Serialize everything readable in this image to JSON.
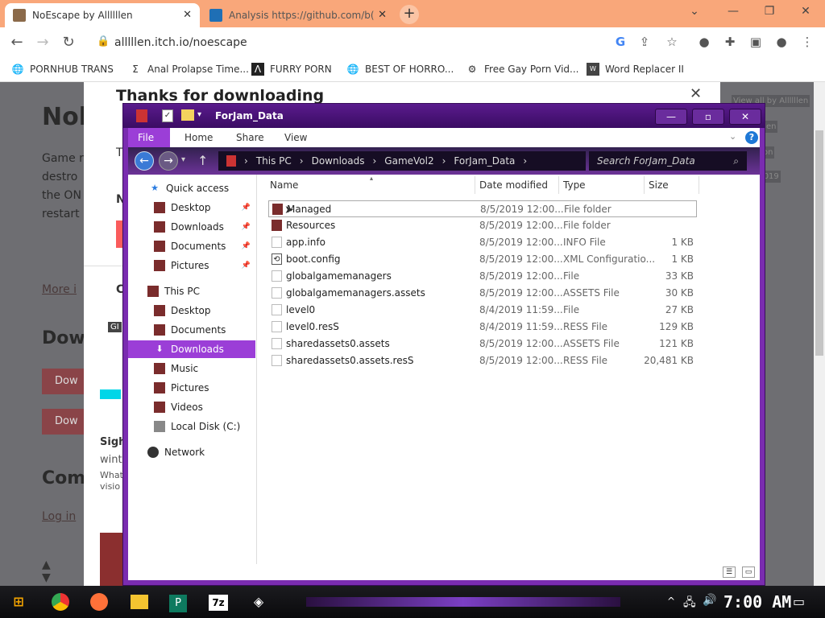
{
  "browser": {
    "tabs": [
      {
        "title": "NoEscape by Allllllen"
      },
      {
        "title": "Analysis https://github.com/b("
      }
    ],
    "new_tab": "+",
    "url": "alllllen.itch.io/noescape",
    "bookmarks": [
      "PORNHUB TRANS",
      "Anal Prolapse Time...",
      "FURRY PORN",
      "BEST OF HORRO...",
      "Free Gay Porn Vid...",
      "Word Replacer II"
    ]
  },
  "page_behind": {
    "title": "Nol",
    "modal_title": "Thanks for downloading",
    "text_lines": [
      "Game r",
      "destro",
      "the ON",
      "restart"
    ],
    "more_link": "More i",
    "downloads_heading": "Dow",
    "download_buttons": [
      "Dow",
      "Dow"
    ],
    "sigh": "Sigh",
    "wint": "wint",
    "what": "What",
    "visio": "visio",
    "comments": "Com",
    "login": "Log in",
    "right_labels": [
      "View all by Allllllen",
      "ow Allllllen",
      "Collection",
      "e Jam 2019"
    ],
    "small_g": "GI",
    "small_c": "C",
    "small_n": "N",
    "small_t": "T"
  },
  "explorer": {
    "title": "ForJam_Data",
    "ribbon_tabs": [
      "File",
      "Home",
      "Share",
      "View"
    ],
    "breadcrumbs": [
      "This PC",
      "Downloads",
      "GameVol2",
      "ForJam_Data"
    ],
    "search_placeholder": "Search ForJam_Data",
    "nav_items": [
      {
        "label": "Quick access"
      },
      {
        "label": "Desktop"
      },
      {
        "label": "Downloads"
      },
      {
        "label": "Documents"
      },
      {
        "label": "Pictures"
      },
      {
        "label": "This PC"
      },
      {
        "label": "Desktop"
      },
      {
        "label": "Documents"
      },
      {
        "label": "Downloads"
      },
      {
        "label": "Music"
      },
      {
        "label": "Pictures"
      },
      {
        "label": "Videos"
      },
      {
        "label": "Local Disk (C:)"
      },
      {
        "label": "Network"
      }
    ],
    "columns": [
      "Name",
      "Date modified",
      "Type",
      "Size"
    ],
    "files": [
      {
        "name": "Managed",
        "date": "8/5/2019 12:00...",
        "type": "File folder",
        "size": ""
      },
      {
        "name": "Resources",
        "date": "8/5/2019 12:00...",
        "type": "File folder",
        "size": ""
      },
      {
        "name": "app.info",
        "date": "8/5/2019 12:00...",
        "type": "INFO File",
        "size": "1 KB"
      },
      {
        "name": "boot.config",
        "date": "8/5/2019 12:00...",
        "type": "XML Configuratio...",
        "size": "1 KB"
      },
      {
        "name": "globalgamemanagers",
        "date": "8/5/2019 12:00...",
        "type": "File",
        "size": "33 KB"
      },
      {
        "name": "globalgamemanagers.assets",
        "date": "8/5/2019 12:00...",
        "type": "ASSETS File",
        "size": "30 KB"
      },
      {
        "name": "level0",
        "date": "8/4/2019 11:59...",
        "type": "File",
        "size": "27 KB"
      },
      {
        "name": "level0.resS",
        "date": "8/4/2019 11:59...",
        "type": "RESS File",
        "size": "129 KB"
      },
      {
        "name": "sharedassets0.assets",
        "date": "8/5/2019 12:00...",
        "type": "ASSETS File",
        "size": "121 KB"
      },
      {
        "name": "sharedassets0.assets.resS",
        "date": "8/5/2019 12:00...",
        "type": "RESS File",
        "size": "20,481 KB"
      }
    ]
  },
  "taskbar": {
    "time": "7:00 AM",
    "apps": [
      "start",
      "chrome",
      "firefox",
      "file-explorer",
      "publisher",
      "7zip",
      "unity"
    ],
    "sevenzip_label": "7z"
  },
  "colors": {
    "accent": "#9b3ed7",
    "tabbar": "#f9a77a"
  }
}
